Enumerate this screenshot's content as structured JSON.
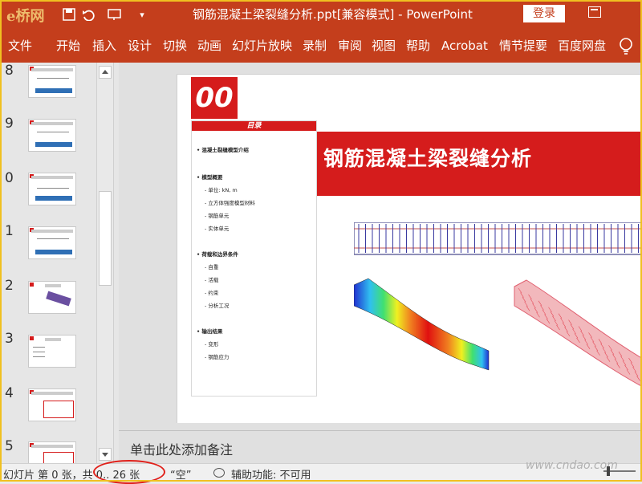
{
  "titlebar": {
    "logo_text": "e桥网",
    "window_title": "钢筋混凝土梁裂缝分析.ppt[兼容模式] - PowerPoint",
    "login_label": "登录"
  },
  "ribbon_tabs": [
    "文件",
    "开始",
    "插入",
    "设计",
    "切换",
    "动画",
    "幻灯片放映",
    "录制",
    "审阅",
    "视图",
    "帮助",
    "Acrobat",
    "情节提要",
    "百度网盘"
  ],
  "thumbnails": {
    "numbers": [
      "8",
      "9",
      "0",
      "1",
      "2",
      "3",
      "4",
      "5"
    ]
  },
  "slide": {
    "badge": "00",
    "toc_header": "目录",
    "banner_title": "钢筋混凝土梁裂缝分析",
    "toc_items": [
      {
        "text": "• 混凝土裂缝模型介绍",
        "level": "main"
      },
      {
        "text": "• 模型概要",
        "level": "main"
      },
      {
        "text": "- 单位: kN, m",
        "level": "sub"
      },
      {
        "text": "- 立方体强度模型材料",
        "level": "sub"
      },
      {
        "text": "- 钢筋单元",
        "level": "sub"
      },
      {
        "text": "- 实体单元",
        "level": "sub"
      },
      {
        "text": "• 荷载和边界条件",
        "level": "main"
      },
      {
        "text": "- 自重",
        "level": "sub"
      },
      {
        "text": "- 活载",
        "level": "sub"
      },
      {
        "text": "- 约束",
        "level": "sub"
      },
      {
        "text": "- 分析工况",
        "level": "sub"
      },
      {
        "text": "• 输出结果",
        "level": "main"
      },
      {
        "text": "- 变形",
        "level": "sub"
      },
      {
        "text": "- 钢筋应力",
        "level": "sub"
      }
    ]
  },
  "notes": {
    "placeholder": "单击此处添加备注"
  },
  "statusbar": {
    "slide_info": "幻灯片 第 0 张，共 0.. 26 张",
    "language": "“空”",
    "accessibility": "辅助功能: 不可用",
    "watermark": "www.cndao.com"
  },
  "colors": {
    "ribbon": "#c43e1c",
    "slide_red": "#d51c1c",
    "highlight": "#e0201a"
  }
}
